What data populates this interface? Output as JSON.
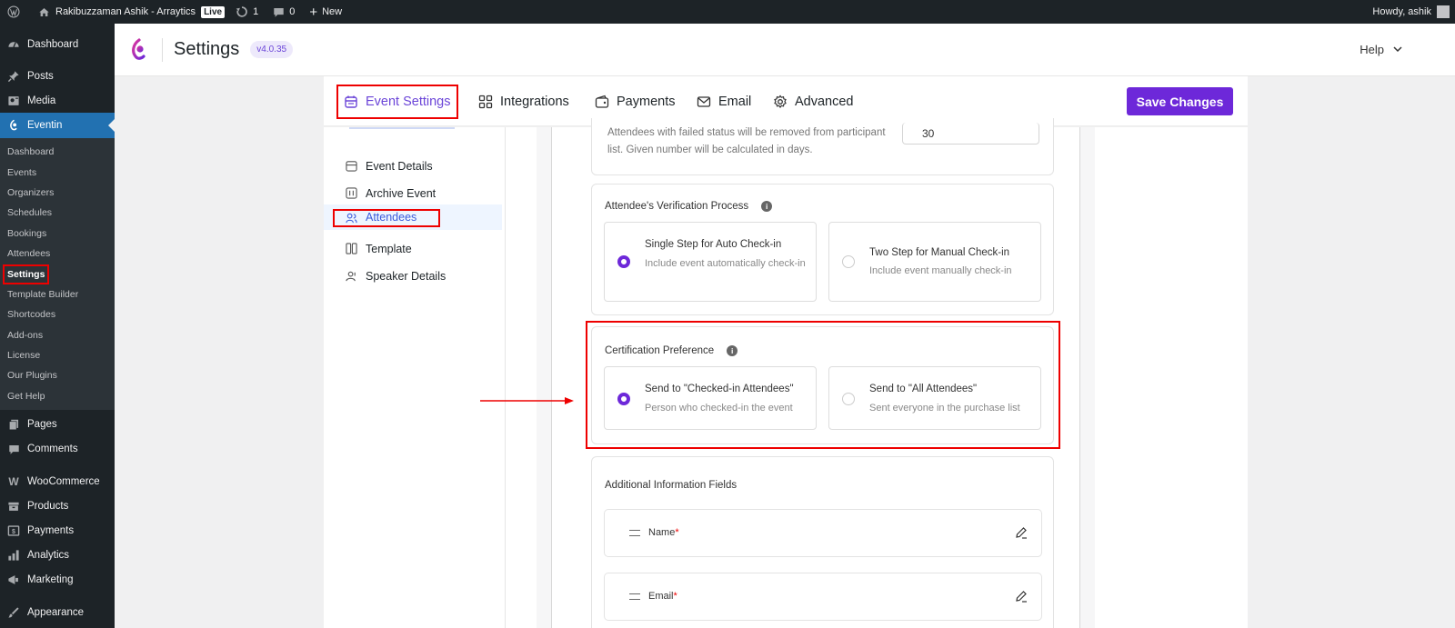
{
  "adminbar": {
    "site_name": "Rakibuzzaman Ashik - Arraytics",
    "live": "Live",
    "updates_count": "1",
    "comments_count": "0",
    "new_label": "New",
    "howdy": "Howdy, ashik"
  },
  "sidebar": {
    "dashboard": "Dashboard",
    "posts": "Posts",
    "media": "Media",
    "eventin": "Eventin",
    "submenu": [
      "Dashboard",
      "Events",
      "Organizers",
      "Schedules",
      "Bookings",
      "Attendees",
      "Settings",
      "Template Builder",
      "Shortcodes",
      "Add-ons",
      "License",
      "Our Plugins",
      "Get Help"
    ],
    "pages": "Pages",
    "comments": "Comments",
    "woocommerce": "WooCommerce",
    "products": "Products",
    "payments": "Payments",
    "analytics": "Analytics",
    "marketing": "Marketing",
    "appearance": "Appearance"
  },
  "header": {
    "title": "Settings",
    "version": "v4.0.35",
    "help": "Help"
  },
  "tabs": {
    "event_settings": "Event Settings",
    "integrations": "Integrations",
    "payments": "Payments",
    "email": "Email",
    "advanced": "Advanced",
    "save": "Save Changes"
  },
  "left_nav": {
    "event_details": "Event Details",
    "archive_event": "Archive Event",
    "attendees": "Attendees",
    "template": "Template",
    "speaker_details": "Speaker Details"
  },
  "content": {
    "failed_status_desc": "Attendees with failed status will be removed from participant list. Given number will be calculated in days.",
    "failed_status_days": "30",
    "verification": {
      "title": "Attendee's Verification Process",
      "option1_title": "Single Step for Auto Check-in",
      "option1_desc": "Include event automatically check-in",
      "option2_title": "Two Step for Manual Check-in",
      "option2_desc": "Include event manually check-in"
    },
    "certification": {
      "title": "Certification Preference",
      "option1_title": "Send to \"Checked-in Attendees\"",
      "option1_desc": "Person who checked-in the event",
      "option2_title": "Send to \"All Attendees\"",
      "option2_desc": "Sent everyone in the purchase list"
    },
    "additional": {
      "title": "Additional Information Fields",
      "fields": [
        "Name",
        "Email"
      ],
      "required_mark": "*"
    }
  },
  "colors": {
    "primary": "#6d28d9",
    "wp_blue": "#2271b1",
    "highlight_red": "#ee0000"
  }
}
